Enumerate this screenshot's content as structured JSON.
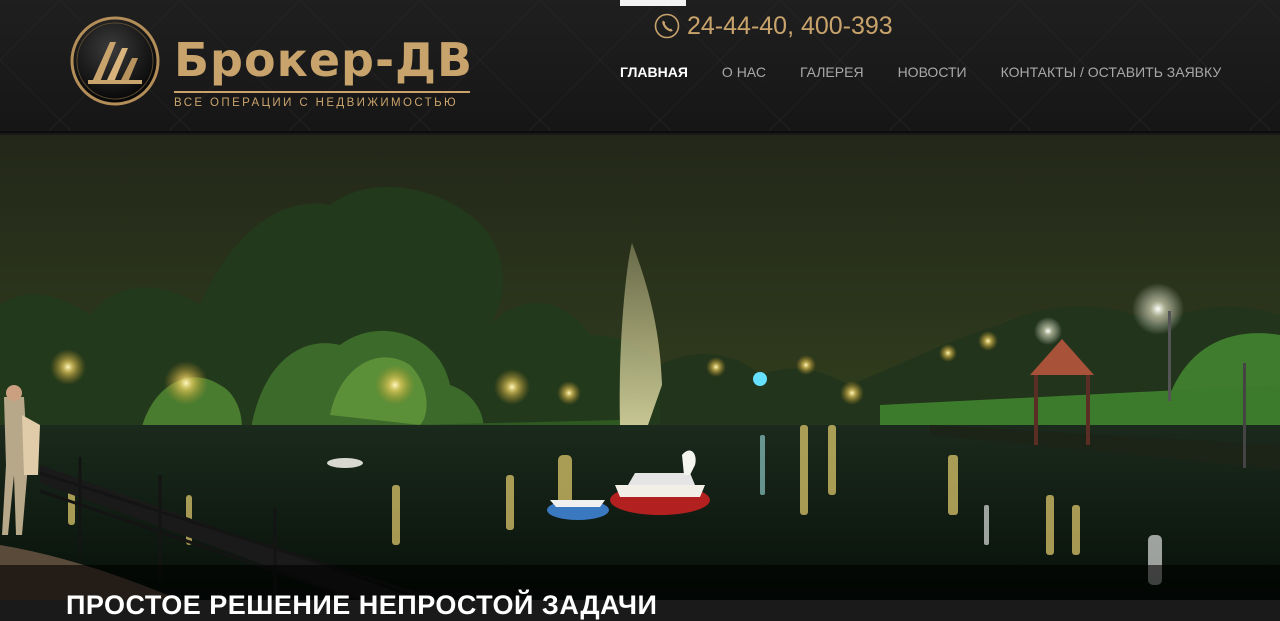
{
  "header": {
    "brand_name": "Брокер-ДВ",
    "tagline": "ВСЕ ОПЕРАЦИИ С НЕДВИЖИМОСТЬЮ",
    "phone": "24-44-40, 400-393",
    "nav": [
      {
        "label": "ГЛАВНАЯ",
        "active": true
      },
      {
        "label": "О НАС",
        "active": false
      },
      {
        "label": "ГАЛЕРЕЯ",
        "active": false
      },
      {
        "label": "НОВОСТИ",
        "active": false
      },
      {
        "label": "КОНТАКТЫ / ОСТАВИТЬ ЗАЯВКУ",
        "active": false
      }
    ]
  },
  "hero": {
    "caption": "ПРОСТОЕ РЕШЕНИЕ НЕПРОСТОЙ ЗАДАЧИ"
  },
  "colors": {
    "accent_gold": "#c9a36c",
    "header_bg": "#1c1c1c",
    "nav_active": "#ffffff",
    "nav_inactive": "#a8a8a8"
  },
  "icons": {
    "phone": "phone-icon",
    "logo": "logo-emblem-icon"
  }
}
